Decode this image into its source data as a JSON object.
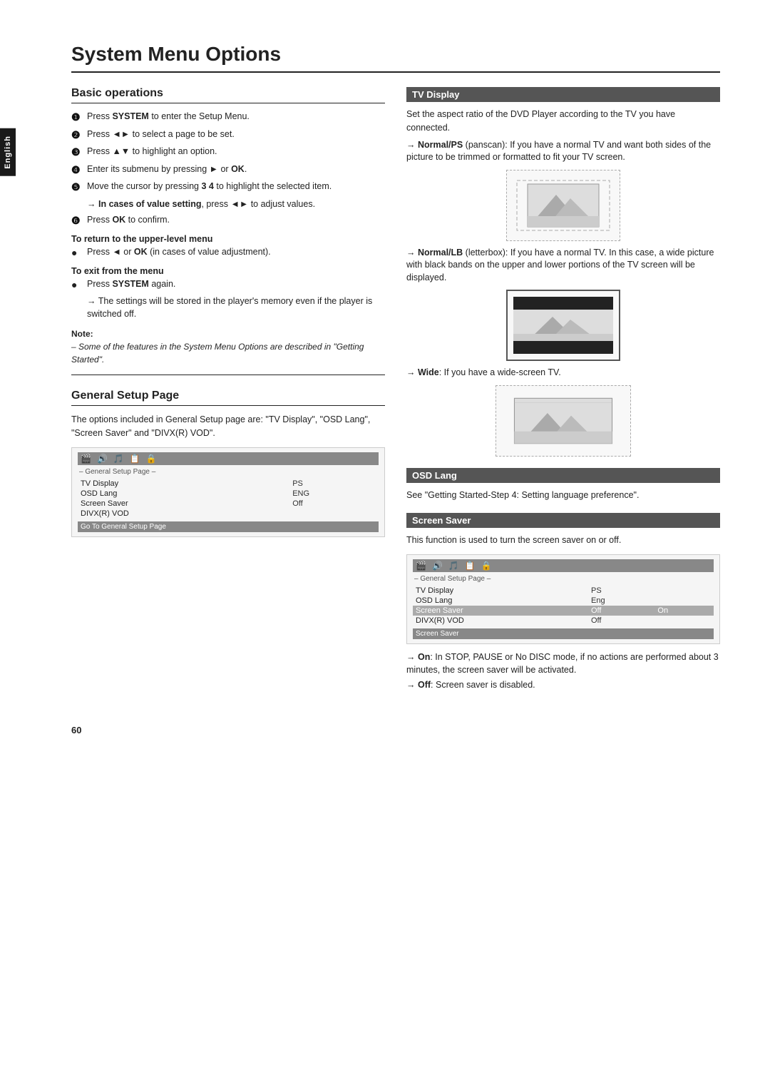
{
  "page": {
    "title": "System Menu Options",
    "page_number": "60",
    "language_tab": "English"
  },
  "left": {
    "basic_operations": {
      "title": "Basic operations",
      "steps": [
        {
          "num": "❶",
          "text": "Press SYSTEM to enter the Setup Menu."
        },
        {
          "num": "❷",
          "text": "Press ◄► to select a page to be set."
        },
        {
          "num": "❸",
          "text": "Press ▲▼ to highlight an option."
        },
        {
          "num": "❹",
          "text": "Enter its submenu by pressing ► or OK."
        },
        {
          "num": "❺",
          "text": "Move the cursor by pressing 3 4 to highlight the selected item."
        }
      ],
      "arrow_note_1": "→ In cases of value setting, press ◄► to adjust values.",
      "step6": {
        "num": "❻",
        "text": "Press OK to confirm."
      },
      "return_heading": "To return to the upper-level menu",
      "return_bullet": "Press ◄ or OK (in cases of value adjustment).",
      "exit_heading": "To exit from the menu",
      "exit_bullet": "Press SYSTEM again.",
      "exit_arrow": "→ The settings will be stored in the player's memory even if the player is switched off.",
      "note_label": "Note:",
      "note_text": "– Some of the features in the System Menu Options are described in \"Getting Started\"."
    },
    "general_setup": {
      "title": "General Setup Page",
      "intro": "The options included in General Setup page are: \"TV Display\", \"OSD Lang\", \"Screen Saver\" and \"DIVX(R) VOD\".",
      "menu": {
        "icons": [
          "🎬",
          "🔊",
          "🎵",
          "📋",
          "🔒"
        ],
        "subtitle": "– General Setup Page –",
        "rows": [
          {
            "label": "TV Display",
            "value": "PS"
          },
          {
            "label": "OSD Lang",
            "value": "ENG"
          },
          {
            "label": "Screen Saver",
            "value": "Off"
          },
          {
            "label": "DIVX(R) VOD",
            "value": ""
          }
        ],
        "bottom": "Go To General Setup Page"
      }
    }
  },
  "right": {
    "tv_display": {
      "title": "TV Display",
      "intro": "Set the aspect ratio of the DVD Player according to the TV you have connected.",
      "normal_ps": {
        "label": "Normal/PS",
        "desc": "(panscan): If you have a normal TV and want both sides of the picture to be trimmed or formatted to fit your TV screen."
      },
      "normal_lb": {
        "label": "Normal/LB",
        "desc": "(letterbox): If you have a normal TV. In this case, a wide picture with black bands on the upper and lower portions of the TV screen will be displayed."
      },
      "wide": {
        "label": "Wide",
        "desc": ": If you have a wide-screen TV."
      }
    },
    "osd_lang": {
      "title": "OSD Lang",
      "text": "See \"Getting Started-Step 4: Setting language preference\"."
    },
    "screen_saver": {
      "title": "Screen Saver",
      "intro": "This function is used to turn the screen saver on or off.",
      "menu": {
        "icons": [
          "🎬",
          "🔊",
          "🎵",
          "📋",
          "🔒"
        ],
        "subtitle": "– General Setup Page –",
        "rows": [
          {
            "label": "TV Display",
            "value": "PS"
          },
          {
            "label": "OSD Lang",
            "value": "Eng"
          },
          {
            "label": "Screen Saver",
            "value": "Off",
            "extra": "On",
            "highlight": true
          },
          {
            "label": "DIVX(R) VOD",
            "value": "Off"
          }
        ],
        "bottom": "Screen Saver"
      },
      "on_note": "→ On: In STOP, PAUSE or No DISC mode, if no actions are performed about 3 minutes, the screen saver will be activated.",
      "off_note": "→ Off: Screen saver is disabled."
    }
  }
}
